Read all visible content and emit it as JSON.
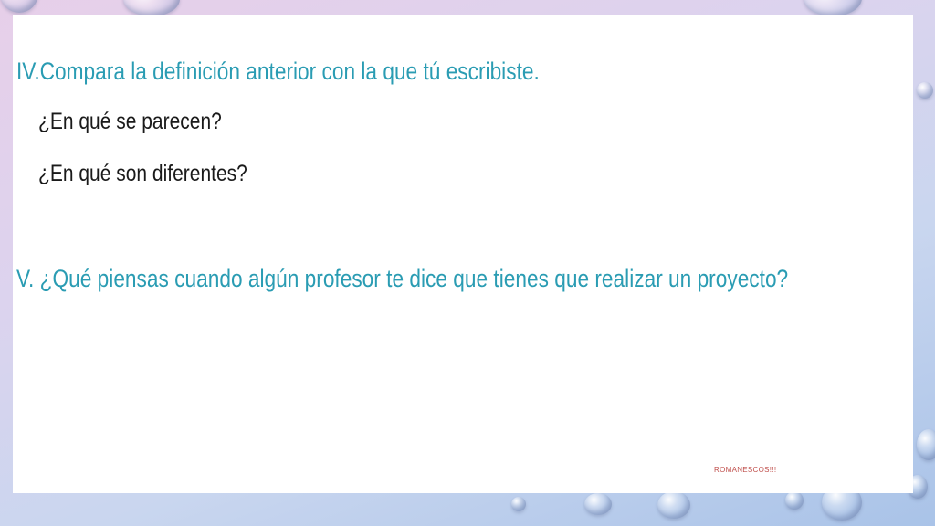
{
  "section4": {
    "heading": "IV.Compara la definición anterior con la que tú escribiste.",
    "questions": [
      "¿En qué se parecen?",
      "¿En qué son diferentes?"
    ]
  },
  "section5": {
    "heading": "V. ¿Qué piensas cuando algún profesor te dice que tienes que realizar un proyecto?"
  },
  "footer": {
    "text": "ROMANESCOS!!!"
  },
  "colors": {
    "heading": "#2a9cb3",
    "answer_lines": "#2ab2d6",
    "footer": "#c0504d"
  }
}
